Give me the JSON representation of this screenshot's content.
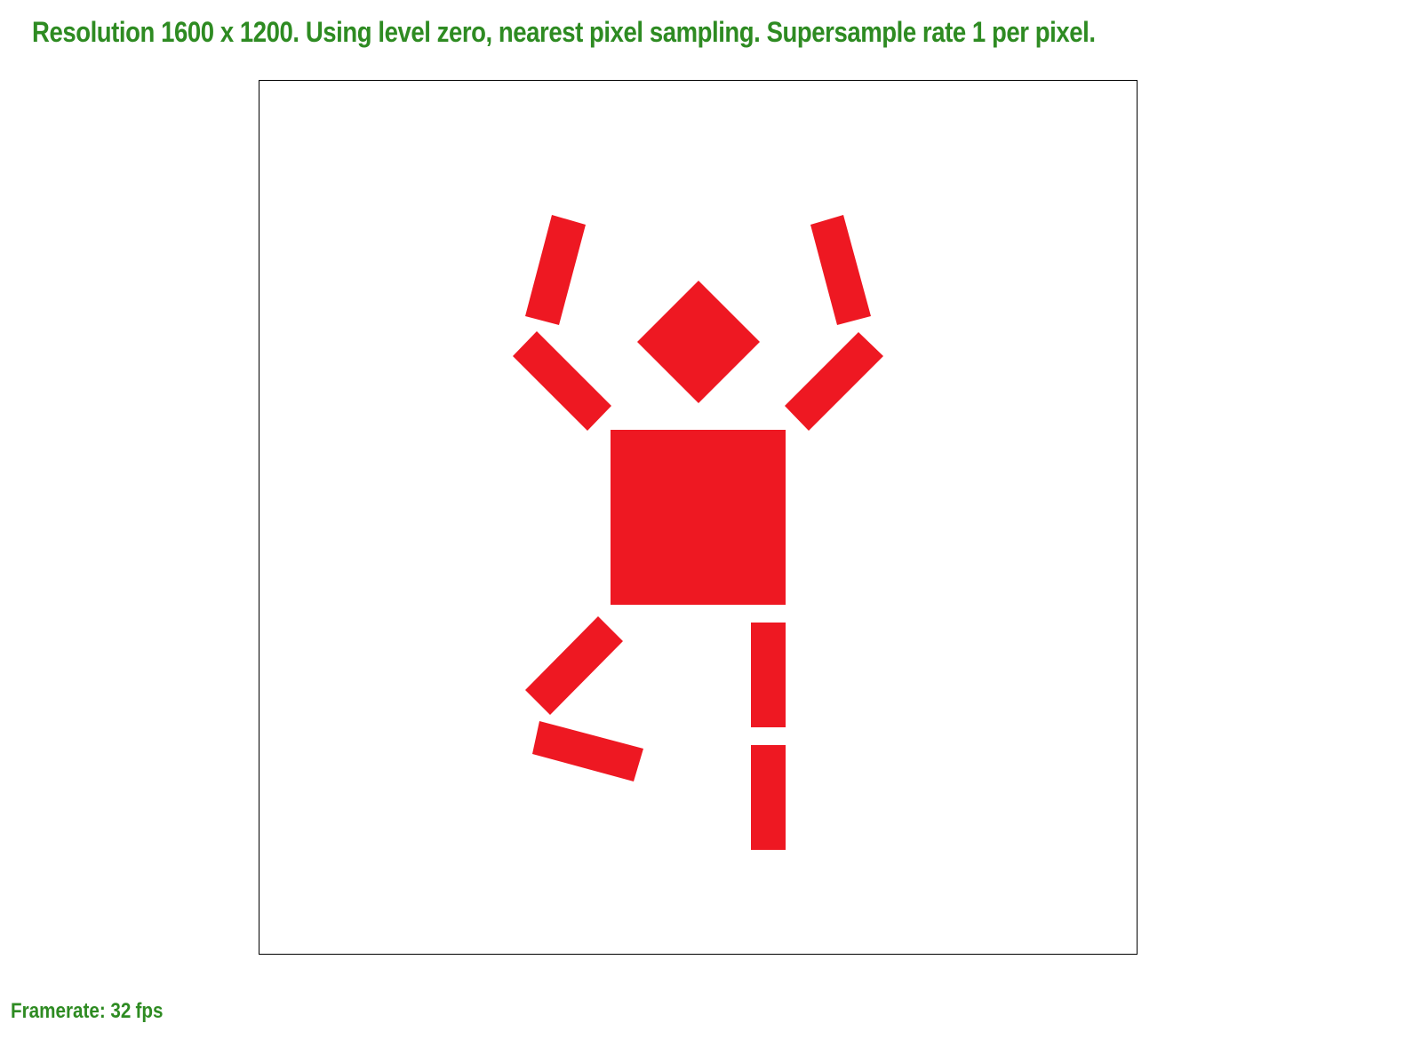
{
  "header": {
    "status_text": "Resolution 1600 x 1200. Using level zero, nearest pixel sampling. Supersample rate 1 per pixel."
  },
  "footer": {
    "framerate_label": "Framerate:",
    "framerate_value": "32",
    "framerate_unit": "fps"
  },
  "colors": {
    "status_text": "#2e8b22",
    "figure_fill": "#ee1822",
    "canvas_background": "#ffffff",
    "canvas_border": "#000000"
  },
  "scene": {
    "subject": "stick figure made of red rectangles and a diamond head",
    "parts": [
      "head",
      "torso",
      "left-upper-arm",
      "left-forearm",
      "right-upper-arm",
      "right-forearm",
      "left-thigh",
      "left-shin",
      "right-thigh",
      "right-shin"
    ]
  }
}
